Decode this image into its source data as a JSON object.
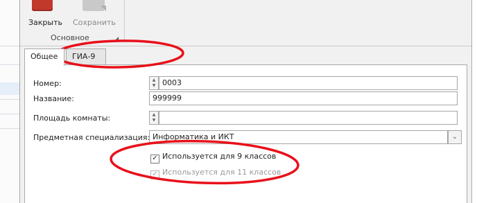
{
  "ribbon": {
    "close_label": "Закрыть",
    "save_label": "Сохранить",
    "group_label": "Основное"
  },
  "tabs": [
    {
      "label": "Общее",
      "active": true
    },
    {
      "label": "ГИА-9",
      "active": false
    }
  ],
  "form": {
    "number": {
      "label": "Номер:",
      "value": "0003"
    },
    "name": {
      "label": "Название:",
      "value": "999999"
    },
    "area": {
      "label": "Площадь комнаты:",
      "value": ""
    },
    "specialization": {
      "label": "Предметная специализация:",
      "value": "Информатика и ИКТ"
    },
    "checkbox_9": {
      "label": "Используется для 9 классов",
      "checked": true
    },
    "checkbox_11": {
      "label": "Используется для 11 классов",
      "checked": true,
      "disabled": true
    }
  },
  "colors": {
    "annotation": "#e8101a",
    "close_icon": "#c0392b"
  }
}
